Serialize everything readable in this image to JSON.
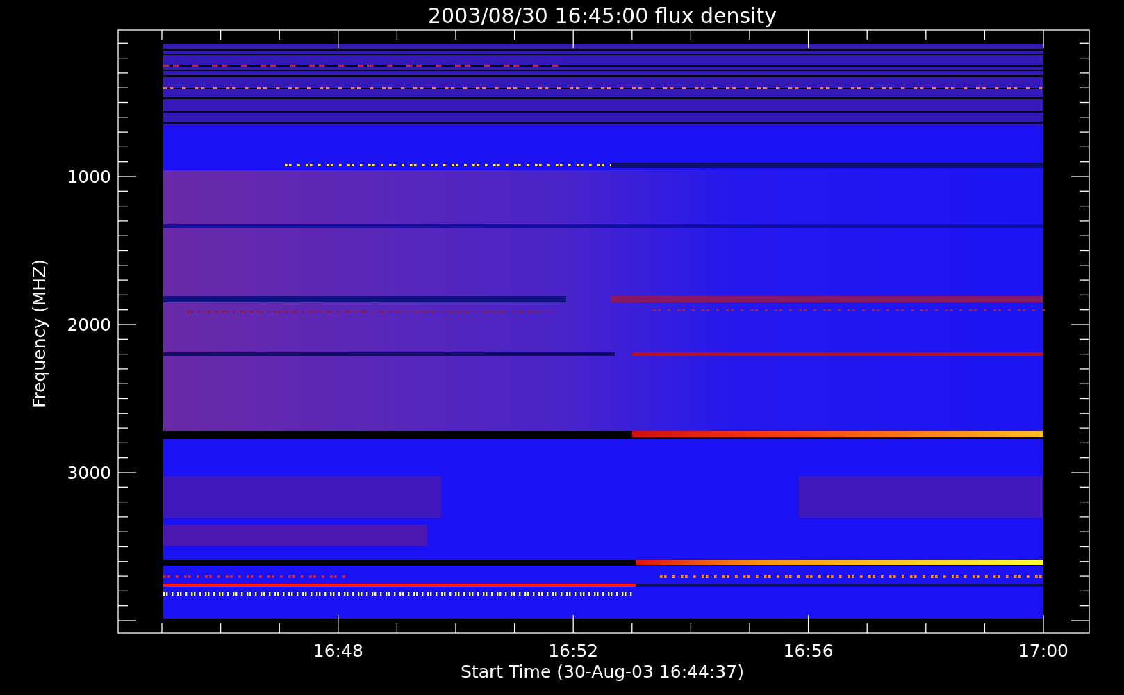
{
  "title": "2003/08/30 16:45:00 flux density",
  "xaxis": {
    "label": "Start Time (30-Aug-03 16:44:37)",
    "ticks": [
      "16:48",
      "16:52",
      "16:56",
      "17:00"
    ]
  },
  "yaxis": {
    "label": "Frequency (MHZ)",
    "ticks": [
      "1000",
      "2000",
      "3000"
    ]
  }
}
